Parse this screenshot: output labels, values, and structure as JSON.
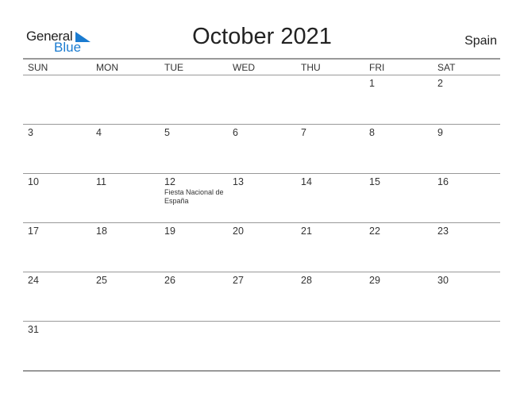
{
  "logo": {
    "general": "General",
    "blue": "Blue",
    "brand_color": "#1a7bd0"
  },
  "title": "October 2021",
  "country": "Spain",
  "weekdays": [
    "SUN",
    "MON",
    "TUE",
    "WED",
    "THU",
    "FRI",
    "SAT"
  ],
  "weeks": [
    [
      "",
      "",
      "",
      "",
      "",
      "1",
      "2"
    ],
    [
      "3",
      "4",
      "5",
      "6",
      "7",
      "8",
      "9"
    ],
    [
      "10",
      "11",
      "12",
      "13",
      "14",
      "15",
      "16"
    ],
    [
      "17",
      "18",
      "19",
      "20",
      "21",
      "22",
      "23"
    ],
    [
      "24",
      "25",
      "26",
      "27",
      "28",
      "29",
      "30"
    ],
    [
      "31",
      "",
      "",
      "",
      "",
      "",
      ""
    ]
  ],
  "events": [
    {
      "day": "12",
      "week": 2,
      "col": 2,
      "name": "Fiesta Nacional de España"
    }
  ]
}
